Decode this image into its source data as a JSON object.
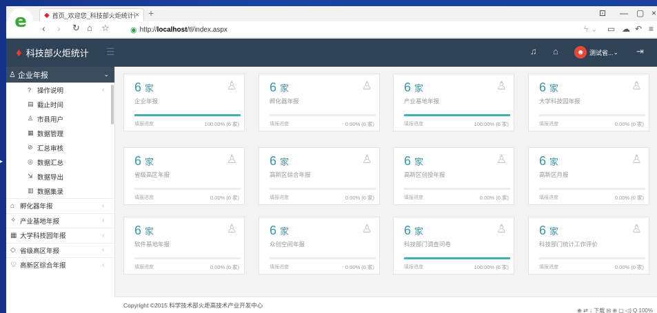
{
  "browser": {
    "tab_title": "首页_欢迎您_科技部火炬统计调查",
    "url_prefix": "http://",
    "url_host": "localhost",
    "url_path": "/tl/index.aspx",
    "new_tab": "+",
    "close_tab": "×"
  },
  "app": {
    "title": "科技部火炬统计",
    "user_name": "测试省...",
    "user_caret": "⌄"
  },
  "sidebar": {
    "active_group": "企业年报",
    "items": [
      {
        "label": "操作说明",
        "icon": "?"
      },
      {
        "label": "截止时间",
        "icon": "▤"
      },
      {
        "label": "市县用户",
        "icon": "♙"
      },
      {
        "label": "数据管理",
        "icon": "▦"
      },
      {
        "label": "汇总审核",
        "icon": "⊘"
      },
      {
        "label": "数据汇总",
        "icon": "◎"
      },
      {
        "label": "数据导出",
        "icon": "⇲"
      },
      {
        "label": "数据集录",
        "icon": "▥"
      }
    ],
    "groups": [
      {
        "label": "孵化器年报",
        "icon": "⌂"
      },
      {
        "label": "产业基地年报",
        "icon": "✧"
      },
      {
        "label": "大学科技园年报",
        "icon": "▦"
      },
      {
        "label": "省级高区年报",
        "icon": "◇"
      },
      {
        "label": "高新区综合年报",
        "icon": "♡"
      }
    ]
  },
  "cards": [
    {
      "count": "6",
      "unit": "家",
      "label": "企业年报",
      "progress_label": "填报进度",
      "progress_text": "100.00% (6 家)",
      "progress": 1.0
    },
    {
      "count": "6",
      "unit": "家",
      "label": "孵化器年报",
      "progress_label": "填报进度",
      "progress_text": "0.00% (0 家)",
      "progress": 0
    },
    {
      "count": "6",
      "unit": "家",
      "label": "产业基地年报",
      "progress_label": "填报进度",
      "progress_text": "100.00% (6 家)",
      "progress": 1.0
    },
    {
      "count": "6",
      "unit": "家",
      "label": "大学科技园年报",
      "progress_label": "填报进度",
      "progress_text": "0.00% (0 家)",
      "progress": 0
    },
    {
      "count": "6",
      "unit": "家",
      "label": "省级高区年报",
      "progress_label": "填报进度",
      "progress_text": "0.00% (0 家)",
      "progress": 0
    },
    {
      "count": "6",
      "unit": "家",
      "label": "高新区综合年报",
      "progress_label": "填报进度",
      "progress_text": "0.00% (0 家)",
      "progress": 0
    },
    {
      "count": "6",
      "unit": "家",
      "label": "高新区创投年报",
      "progress_label": "填报进度",
      "progress_text": "0.00% (0 家)",
      "progress": 0
    },
    {
      "count": "6",
      "unit": "家",
      "label": "高新区月报",
      "progress_label": "填报进度",
      "progress_text": "0.00% (0 家)",
      "progress": 0
    },
    {
      "count": "6",
      "unit": "家",
      "label": "软件基地年报",
      "progress_label": "填报进度",
      "progress_text": "0.00% (0 家)",
      "progress": 0
    },
    {
      "count": "6",
      "unit": "家",
      "label": "众创空间年报",
      "progress_label": "填报进度",
      "progress_text": "0.00% (0 家)",
      "progress": 0
    },
    {
      "count": "6",
      "unit": "家",
      "label": "科技部门调查问卷",
      "progress_label": "填报进度",
      "progress_text": "100.00% (6 家)",
      "progress": 1.0
    },
    {
      "count": "6",
      "unit": "家",
      "label": "科技部门统计工作评价",
      "progress_label": "填报进度",
      "progress_text": "0.00% (0 家)",
      "progress": 0
    }
  ],
  "footer": {
    "copyright": "Copyright ©2015 科学技术部火炬高技术产业开发中心"
  },
  "statusbar": {
    "text": "⊕   ⇄   ↓ 下载   ⊟   ⊕   ▢   ◁)   Q 100%"
  },
  "colors": {
    "header": "#2f4256",
    "accent": "#3a97a8",
    "progress": "#3fb3b1"
  }
}
